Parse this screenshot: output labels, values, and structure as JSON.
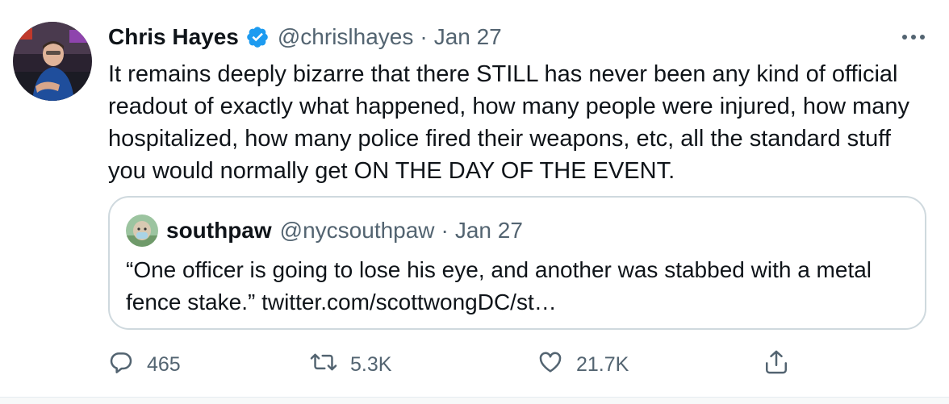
{
  "tweet": {
    "author_name": "Chris Hayes",
    "handle": "@chrislhayes",
    "separator": "·",
    "date": "Jan 27",
    "text": "It remains deeply bizarre that there STILL has never been any kind of official readout of exactly what happened, how many people were injured, how many hospitalized, how many police fired their weapons, etc, all the standard stuff you would normally get ON THE DAY OF THE EVENT.",
    "verified_icon": "verified-badge-icon",
    "more_icon": "more-dots-icon"
  },
  "quote": {
    "author_name": "southpaw",
    "handle": "@nycsouthpaw",
    "separator": "·",
    "date": "Jan 27",
    "text": "“One officer is going to lose his eye, and another was stabbed with a metal fence stake.” twitter.com/scottwongDC/st…"
  },
  "actions": {
    "replies": "465",
    "retweets": "5.3K",
    "likes": "21.7K",
    "reply_icon": "reply-icon",
    "retweet_icon": "retweet-icon",
    "like_icon": "heart-icon",
    "share_icon": "share-icon"
  },
  "colors": {
    "verified_blue": "#1d9bf0",
    "muted_text": "#536471",
    "border": "#cfd9de"
  }
}
